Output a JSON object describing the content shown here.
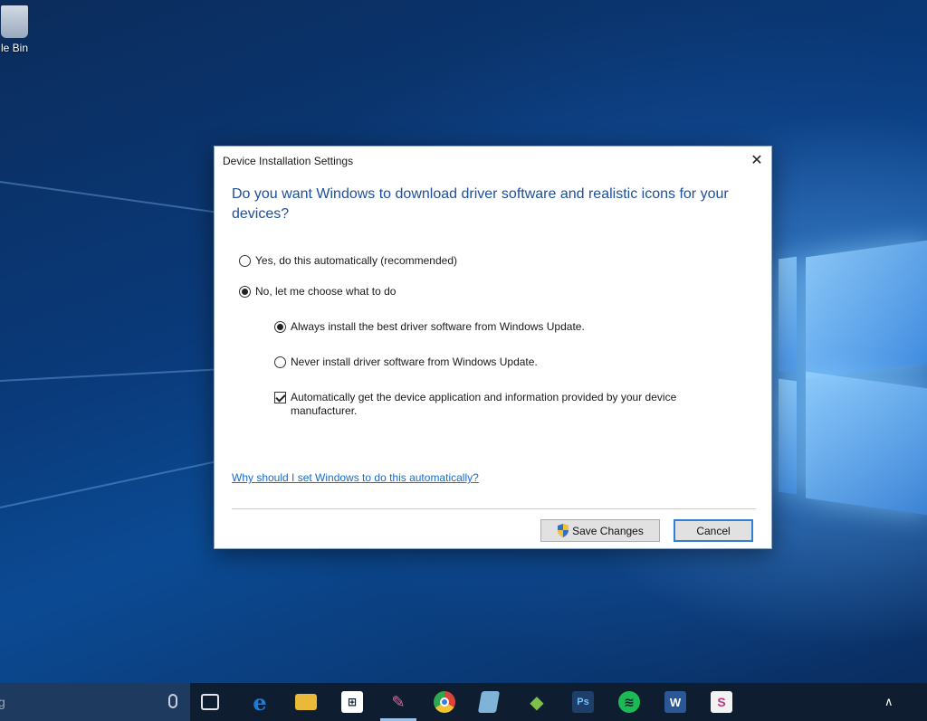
{
  "desktop": {
    "recycle_bin_label": "le Bin"
  },
  "dialog": {
    "title": "Device Installation Settings",
    "close_glyph": "✕",
    "heading": "Do you want Windows to download driver software and realistic icons for your devices?",
    "options": {
      "yes_auto": {
        "label": "Yes, do this automatically (recommended)",
        "checked": false
      },
      "no_choose": {
        "label": "No, let me choose what to do",
        "checked": true
      },
      "always_install": {
        "label": "Always install the best driver software from Windows Update.",
        "checked": true
      },
      "never_install": {
        "label": "Never install driver software from Windows Update.",
        "checked": false
      },
      "auto_get_app": {
        "label": "Automatically get the device application and information provided by your device manufacturer.",
        "checked": true
      }
    },
    "help_link": "Why should I set Windows to do this automatically?",
    "buttons": {
      "save": "Save Changes",
      "cancel": "Cancel"
    }
  },
  "taskbar": {
    "search_text": "g",
    "icons": [
      {
        "name": "task-view-icon",
        "glyph": "▢",
        "color": "#0f1d31"
      },
      {
        "name": "edge-icon",
        "glyph": "e",
        "color": "#1f7ad6"
      },
      {
        "name": "file-explorer-icon",
        "glyph": "▬",
        "color": "#e9b93a"
      },
      {
        "name": "store-icon",
        "glyph": "⊞",
        "color": "#ffffff"
      },
      {
        "name": "paint-icon",
        "glyph": "✎",
        "color": "#d86a9a"
      },
      {
        "name": "chrome-icon",
        "glyph": "●",
        "color": "#d9453a"
      },
      {
        "name": "notepad-icon",
        "glyph": "▤",
        "color": "#7fb4d8"
      },
      {
        "name": "sketchup-icon",
        "glyph": "◆",
        "color": "#7cc04a"
      },
      {
        "name": "photoshop-icon",
        "glyph": "Ps",
        "color": "#1d3f6a"
      },
      {
        "name": "spotify-icon",
        "glyph": "≋",
        "color": "#1db954"
      },
      {
        "name": "word-icon",
        "glyph": "W",
        "color": "#2b5797"
      },
      {
        "name": "slack-icon",
        "glyph": "S",
        "color": "#f2f2f2"
      }
    ],
    "tray_chevron": "∧"
  }
}
